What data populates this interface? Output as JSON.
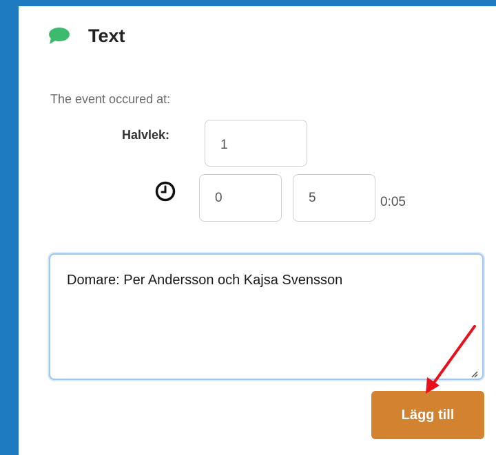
{
  "header": {
    "title": "Text",
    "icon": "chat-bubble-icon",
    "icon_color": "#3cba6e"
  },
  "event": {
    "label": "The event occured at:",
    "halvlek_label": "Halvlek:",
    "halvlek_value": "1",
    "minutes_value": "0",
    "seconds_value": "5",
    "time_display": "0:05",
    "clock_icon": "clock-icon"
  },
  "comment": {
    "value": "Domare: Per Andersson och Kajsa Svensson"
  },
  "actions": {
    "add_label": "Lägg till",
    "add_color": "#d3822f"
  },
  "annotation": {
    "arrow_color": "#e8101a"
  }
}
